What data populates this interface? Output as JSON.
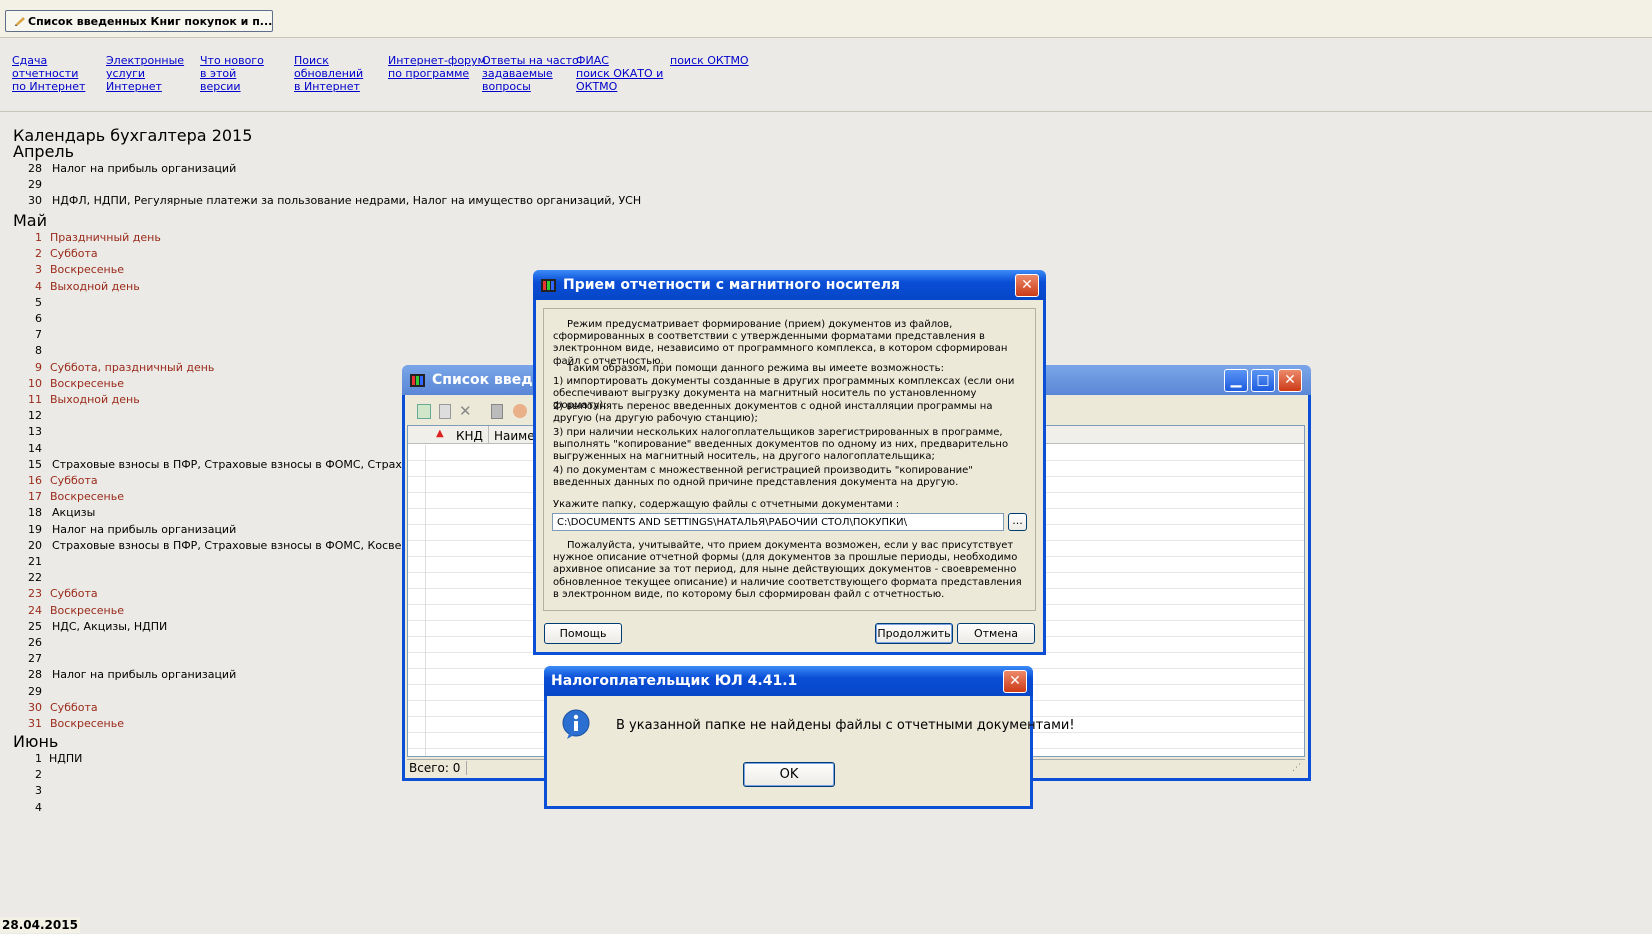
{
  "taskbar": {
    "button_label": "Список введенных Книг покупок и п..."
  },
  "links": [
    "Сдача\nотчетности\nпо Интернет",
    "Электронные\nуслуги\nИнтернет",
    "Что нового\nв этой\nверсии",
    "Поиск\nобновлений\nв Интернет",
    "Интернет-форум\nпо программе",
    "Ответы на часто\nзадаваемые\nвопросы",
    "ФИАС\nпоиск ОКАТО и\nОКТМО",
    "поиск ОКТМО"
  ],
  "calendar": {
    "title": "Календарь бухгалтера 2015",
    "months": {
      "april": "Апрель",
      "may": "Май",
      "june": "Июнь"
    },
    "april": [
      {
        "d": "28",
        "t": "Налог на прибыль организаций",
        "h": false
      },
      {
        "d": "29",
        "t": "",
        "h": false
      },
      {
        "d": "30",
        "t": "НДФЛ, НДПИ, Регулярные платежи за пользование недрами, Налог на имущество организаций, УСН",
        "h": false
      }
    ],
    "may": [
      {
        "d": "1",
        "t": "Праздничный день",
        "h": true
      },
      {
        "d": "2",
        "t": "Суббота",
        "h": true
      },
      {
        "d": "3",
        "t": "Воскресенье",
        "h": true
      },
      {
        "d": "4",
        "t": "Выходной день",
        "h": true
      },
      {
        "d": "5",
        "t": "",
        "h": false
      },
      {
        "d": "6",
        "t": "",
        "h": false
      },
      {
        "d": "7",
        "t": "",
        "h": false
      },
      {
        "d": "8",
        "t": "",
        "h": false
      },
      {
        "d": "9",
        "t": "Суббота, праздничный день",
        "h": true
      },
      {
        "d": "10",
        "t": "Воскресенье",
        "h": true
      },
      {
        "d": "11",
        "t": "Выходной день",
        "h": true
      },
      {
        "d": "12",
        "t": "",
        "h": false
      },
      {
        "d": "13",
        "t": "",
        "h": false
      },
      {
        "d": "14",
        "t": "",
        "h": false
      },
      {
        "d": "15",
        "t": "Страховые взносы в ПФР, Страховые взносы в ФОМС, Страховые взно",
        "h": false
      },
      {
        "d": "16",
        "t": "Суббота",
        "h": true
      },
      {
        "d": "17",
        "t": "Воскресенье",
        "h": true
      },
      {
        "d": "18",
        "t": "Акцизы",
        "h": false
      },
      {
        "d": "19",
        "t": "Налог на прибыль организаций",
        "h": false
      },
      {
        "d": "20",
        "t": "Страховые взносы в ПФР, Страховые взносы в ФОМС, Косвенные нал",
        "h": false
      },
      {
        "d": "21",
        "t": "",
        "h": false
      },
      {
        "d": "22",
        "t": "",
        "h": false
      },
      {
        "d": "23",
        "t": "Суббота",
        "h": true
      },
      {
        "d": "24",
        "t": "Воскресенье",
        "h": true
      },
      {
        "d": "25",
        "t": "НДС, Акцизы, НДПИ",
        "h": false
      },
      {
        "d": "26",
        "t": "",
        "h": false
      },
      {
        "d": "27",
        "t": "",
        "h": false
      },
      {
        "d": "28",
        "t": "Налог на прибыль организаций",
        "h": false
      },
      {
        "d": "29",
        "t": "",
        "h": false
      },
      {
        "d": "30",
        "t": "Суббота",
        "h": true
      },
      {
        "d": "31",
        "t": "Воскресенье",
        "h": true
      }
    ],
    "june": [
      {
        "d": "1",
        "t": "НДПИ",
        "h": false
      },
      {
        "d": "2",
        "t": "",
        "h": false
      },
      {
        "d": "3",
        "t": "",
        "h": false
      },
      {
        "d": "4",
        "t": "",
        "h": false
      }
    ]
  },
  "status_date": "28.04.2015",
  "list_window": {
    "title": "Список введе",
    "col_knd": "КНД",
    "col_name": "Наиме",
    "status": "Всего: 0"
  },
  "import_dialog": {
    "title": "Прием отчетности с магнитного носителя",
    "p1": "Режим предусматривает формирование (прием) документов из файлов, сформированных в соответствии с утвержденными форматами представления в электронном виде, независимо от программного комплекса, в котором сформирован файл с отчетностью.",
    "p2": "Таким образом, при помощи данного режима вы имеете возможность:",
    "p3": "1)  импортировать документы созданные в других программных комплексах (если они обеспечивают выгрузку документа на магнитный носитель по установленному формату);",
    "p4": "2)  выполнять перенос введенных документов с одной инсталляции программы на другую (на другую рабочую станцию);",
    "p5": "3)  при наличии нескольких налогоплательщиков зарегистрированных в программе, выполнять \"копирование\" введенных документов по одному из них, предварительно выгруженных на магнитный носитель, на другого налогоплательщика;",
    "p6": "4)  по документам с множественной регистрацией производить \"копирование\" введенных данных по одной причине представления документа на другую.",
    "folder_label": "Укажите папку, содержащую файлы с отчетными документами :",
    "folder_value": "C:\\DOCUMENTS AND SETTINGS\\НАТАЛЬЯ\\РАБОЧИЙ СТОЛ\\ПОКУПКИ\\",
    "browse_label": "...",
    "p7": "Пожалуйста, учитывайте, что прием документа возможен, если у вас присутствует нужное описание отчетной формы (для документов за прошлые периоды, необходимо архивное описание за тот период, для ныне действующих документов - своевременно обновленное текущее описание) и наличие соответствующего формата представления в электронном виде, по которому был сформирован файл с отчетностью.",
    "help_label": "Помощь",
    "continue_label": "Продолжить",
    "cancel_label": "Отмена"
  },
  "message_box": {
    "title": "Налогоплательщик ЮЛ 4.41.1",
    "message": "В указанной папке не найдены файлы с отчетными документами!",
    "ok_label": "OK"
  }
}
